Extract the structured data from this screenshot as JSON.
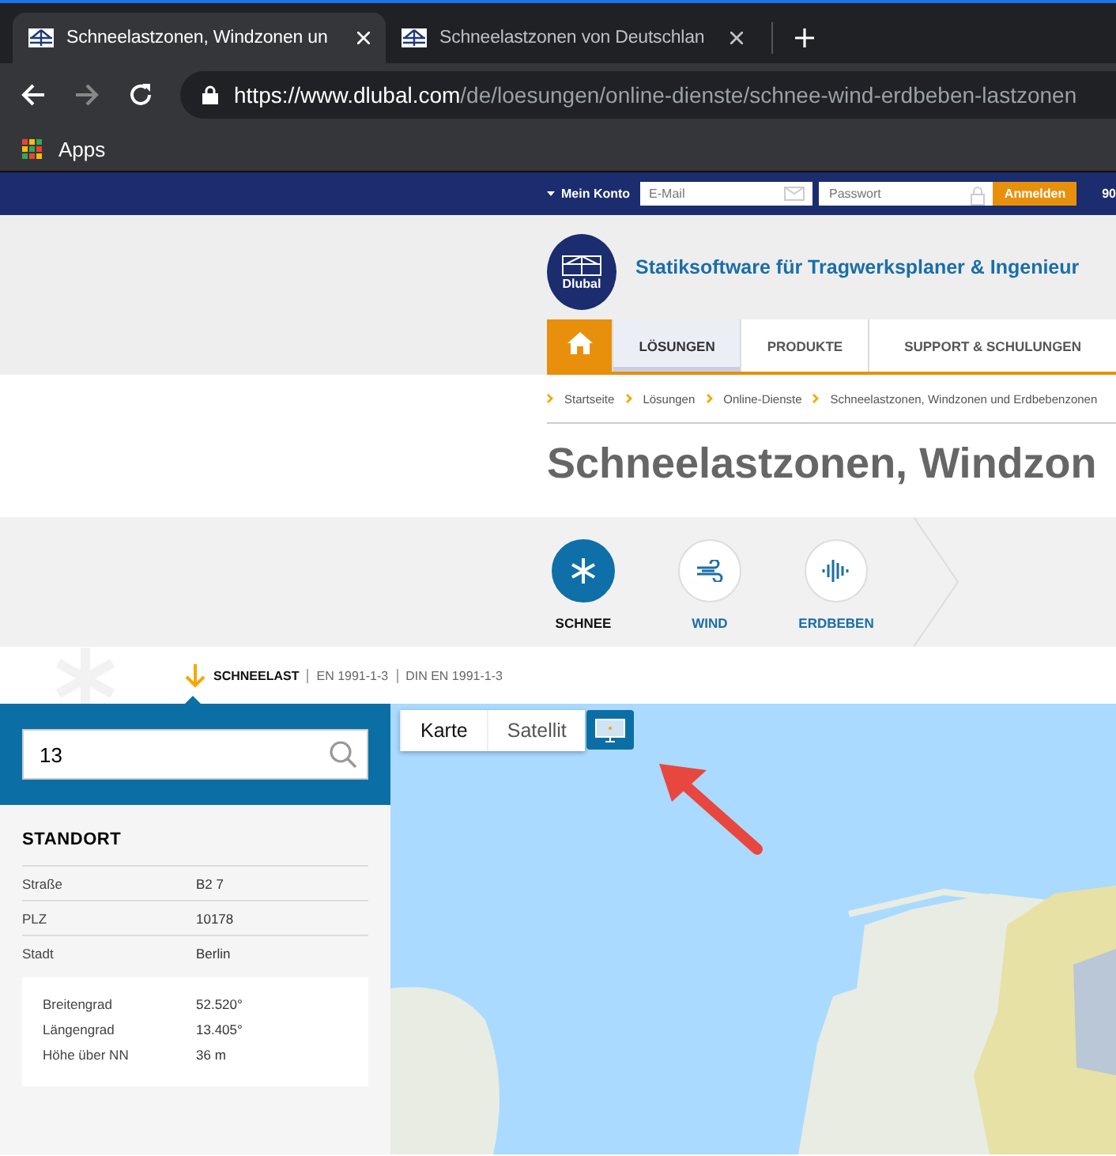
{
  "browser": {
    "tabs": [
      {
        "title": "Schneelastzonen, Windzonen un",
        "selected": true
      },
      {
        "title": "Schneelastzonen von Deutschlan",
        "selected": false
      }
    ],
    "url": {
      "host": "https://www.dlubal.com",
      "path": "/de/loesungen/online-dienste/schnee-wind-erdbeben-lastzonen"
    },
    "bookmarks": [
      "Apps"
    ]
  },
  "topbar": {
    "account": "Mein Konto",
    "email_placeholder": "E-Mail",
    "password_placeholder": "Passwort",
    "login": "Anmelden",
    "phone": "90"
  },
  "header": {
    "logo": "Dlubal",
    "tagline": "Statiksoftware für Tragwerksplaner & Ingenieur"
  },
  "nav": [
    {
      "label": "LÖSUNGEN",
      "selected": true
    },
    {
      "label": "PRODUKTE",
      "selected": false
    },
    {
      "label": "SUPPORT & SCHULUNGEN",
      "selected": false
    }
  ],
  "breadcrumbs": [
    "Startseite",
    "Lösungen",
    "Online-Dienste",
    "Schneelastzonen, Windzonen und Erdbebenzonen"
  ],
  "page_title": "Schneelastzonen, Windzon",
  "load_types": [
    {
      "kind": "snow",
      "label": "SCHNEE",
      "selected": true
    },
    {
      "kind": "wind",
      "label": "WIND",
      "selected": false
    },
    {
      "kind": "quake",
      "label": "ERDBEBEN",
      "selected": false
    }
  ],
  "standard": [
    "SCHNEELAST",
    "EN 1991-1-3",
    "DIN EN 1991-1-3"
  ],
  "search": {
    "value": "13"
  },
  "location": {
    "title": "STANDORT",
    "rows": [
      {
        "label": "Straße",
        "value": "B2 7"
      },
      {
        "label": "PLZ",
        "value": "10178"
      },
      {
        "label": "Stadt",
        "value": "Berlin"
      }
    ],
    "coords": [
      {
        "label": "Breitengrad",
        "value": "52.520°"
      },
      {
        "label": "Längengrad",
        "value": "13.405°"
      },
      {
        "label": "Höhe über NN",
        "value": "36 m"
      }
    ]
  },
  "map": {
    "types": [
      {
        "label": "Karte",
        "selected": true
      },
      {
        "label": "Satellit",
        "selected": false
      }
    ]
  }
}
